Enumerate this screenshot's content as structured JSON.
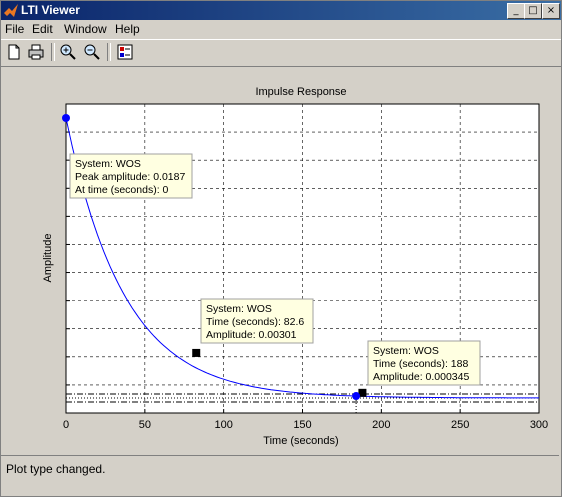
{
  "window": {
    "title": "LTI Viewer"
  },
  "menu": [
    "File",
    "Edit",
    "Window",
    "Help"
  ],
  "toolbar": {
    "icons": [
      "new-icon",
      "print-icon",
      "zoom-in-icon",
      "zoom-out-icon",
      "plot-configuration-icon"
    ]
  },
  "status": {
    "text": "Plot type changed."
  },
  "colors": {
    "curve": "#0000ff",
    "axes_bg": "#ffffff",
    "tip_bg": "#ffffe1",
    "titlebar": "#0a246a"
  },
  "chart_data": {
    "type": "line",
    "title": "Impulse Response",
    "xlabel": "Time (seconds)",
    "ylabel": "Amplitude",
    "xlim": [
      0,
      300
    ],
    "ylim": [
      0,
      0.0187
    ],
    "grid": true,
    "xticks": [
      0,
      50,
      100,
      150,
      200,
      250,
      300
    ],
    "series": [
      {
        "name": "WOS",
        "x": [
          0,
          10,
          20,
          30,
          40,
          50,
          60,
          70,
          82.6,
          100,
          120,
          140,
          160,
          188,
          220,
          260,
          300
        ],
        "y": [
          0.0187,
          0.0156,
          0.0131,
          0.011,
          0.0092,
          0.0077,
          0.0064,
          0.0052,
          0.00301,
          0.00235,
          0.00165,
          0.0011,
          0.00072,
          0.000345,
          0.00016,
          6e-05,
          2e-05
        ]
      }
    ],
    "datatips": [
      {
        "lines": [
          "System: WOS",
          "Peak amplitude: 0.0187",
          "At time (seconds): 0"
        ],
        "x": 0,
        "y": 0.0187,
        "marker": "circle"
      },
      {
        "lines": [
          "System: WOS",
          "Time (seconds): 82.6",
          "Amplitude: 0.00301"
        ],
        "x": 82.6,
        "y": 0.00301,
        "marker": "square"
      },
      {
        "lines": [
          "System: WOS",
          "Time (seconds): 188",
          "Amplitude: 0.000345"
        ],
        "x": 188,
        "y": 0.000345,
        "marker": "square"
      }
    ]
  }
}
